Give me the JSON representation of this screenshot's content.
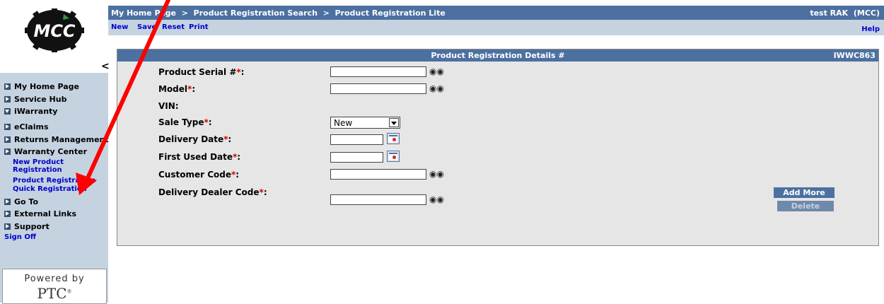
{
  "header": {
    "breadcrumb": "My Home Page  >  Product Registration Search  >  Product Registration Lite",
    "user": "test RAK  (MCC)"
  },
  "toolbar": {
    "new": "New",
    "save": "Save",
    "reset": "Reset",
    "print": "Print",
    "help": "Help"
  },
  "logo": {
    "text": "MCC"
  },
  "sidebar": {
    "collapse": "<",
    "my_home_page": "My Home Page",
    "service_hub": "Service Hub",
    "iwarranty": "iWarranty",
    "eclaims": "eClaims",
    "returns_management": "Returns Management",
    "warranty_center": "Warranty Center",
    "new_product_registration": "New Product Registration",
    "product_registration": "Product Registration",
    "quick_registration": "Quick Registration",
    "go_to": "Go To",
    "external_links": "External Links",
    "support": "Support",
    "sign_off": "Sign Off",
    "powered_by": "Powered by",
    "ptc": "PTC"
  },
  "panel": {
    "title": "Product Registration Details #",
    "id": "IWWC863",
    "fields": {
      "product_serial": "Product Serial #",
      "model": "Model",
      "vin": "VIN:",
      "sale_type": "Sale Type",
      "delivery_date": "Delivery Date",
      "first_used_date": "First Used Date",
      "customer_code": "Customer Code",
      "delivery_dealer_code": "Delivery Dealer Code"
    },
    "required_mark": "*",
    "sale_type_value": "New",
    "add_more": "Add More",
    "delete": "Delete"
  },
  "colors": {
    "header_bg": "#4c70a0",
    "sidebar_bg": "#c5d3e0",
    "link": "#0000cc",
    "required": "#cc0000",
    "annotation_arrow": "#ff0000"
  }
}
